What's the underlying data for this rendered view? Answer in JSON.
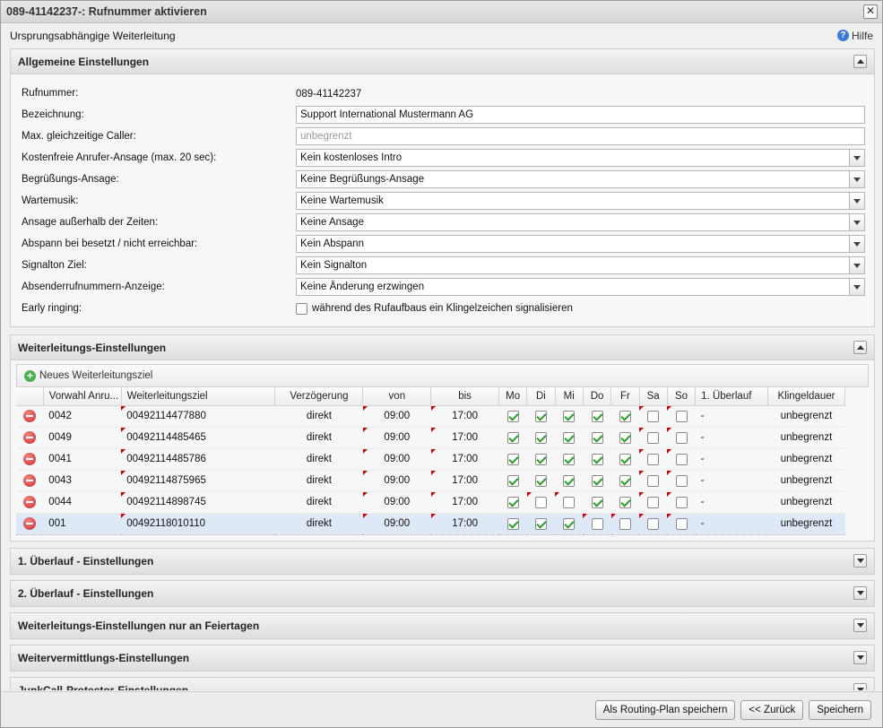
{
  "window": {
    "title": "089-41142237-: Rufnummer aktivieren"
  },
  "subbar": {
    "title": "Ursprungsabhängige Weiterleitung",
    "help_label": "Hilfe"
  },
  "general": {
    "title": "Allgemeine Einstellungen",
    "fields": {
      "rufnummer_label": "Rufnummer:",
      "rufnummer_value": "089-41142237",
      "bezeichnung_label": "Bezeichnung:",
      "bezeichnung_value": "Support International Mustermann AG",
      "max_caller_label": "Max. gleichzeitige Caller:",
      "max_caller_placeholder": "unbegrenzt",
      "intro_label": "Kostenfreie Anrufer-Ansage (max. 20 sec):",
      "intro_value": "Kein kostenloses Intro",
      "greeting_label": "Begrüßungs-Ansage:",
      "greeting_value": "Keine Begrüßungs-Ansage",
      "music_label": "Wartemusik:",
      "music_value": "Keine Wartemusik",
      "offhours_label": "Ansage außerhalb der Zeiten:",
      "offhours_value": "Keine Ansage",
      "outro_label": "Abspann bei besetzt / nicht erreichbar:",
      "outro_value": "Kein Abspann",
      "signal_label": "Signalton Ziel:",
      "signal_value": "Kein Signalton",
      "callerid_label": "Absenderrufnummern-Anzeige:",
      "callerid_value": "Keine Änderung erzwingen",
      "early_label": "Early ringing:",
      "early_text": "während des Rufaufbaus ein Klingelzeichen signalisieren"
    }
  },
  "forwarding": {
    "title": "Weiterleitungs-Einstellungen",
    "add_label": "Neues Weiterleitungsziel",
    "columns": [
      "Vorwahl Anru...",
      "Weiterleitungsziel",
      "Verzögerung",
      "von",
      "bis",
      "Mo",
      "Di",
      "Mi",
      "Do",
      "Fr",
      "Sa",
      "So",
      "1. Überlauf",
      "Klingeldauer"
    ],
    "rows": [
      {
        "vorwahl": "0042",
        "ziel": "00492114477880",
        "delay": "direkt",
        "von": "09:00",
        "bis": "17:00",
        "days": [
          true,
          true,
          true,
          true,
          true,
          false,
          false
        ],
        "overflow": "-",
        "ring": "unbegrenzt"
      },
      {
        "vorwahl": "0049",
        "ziel": "00492114485465",
        "delay": "direkt",
        "von": "09:00",
        "bis": "17:00",
        "days": [
          true,
          true,
          true,
          true,
          true,
          false,
          false
        ],
        "overflow": "-",
        "ring": "unbegrenzt"
      },
      {
        "vorwahl": "0041",
        "ziel": "00492114485786",
        "delay": "direkt",
        "von": "09:00",
        "bis": "17:00",
        "days": [
          true,
          true,
          true,
          true,
          true,
          false,
          false
        ],
        "overflow": "-",
        "ring": "unbegrenzt"
      },
      {
        "vorwahl": "0043",
        "ziel": "00492114875965",
        "delay": "direkt",
        "von": "09:00",
        "bis": "17:00",
        "days": [
          true,
          true,
          true,
          true,
          true,
          false,
          false
        ],
        "overflow": "-",
        "ring": "unbegrenzt"
      },
      {
        "vorwahl": "0044",
        "ziel": "00492114898745",
        "delay": "direkt",
        "von": "09:00",
        "bis": "17:00",
        "days": [
          true,
          false,
          false,
          true,
          true,
          false,
          false
        ],
        "overflow": "-",
        "ring": "unbegrenzt"
      },
      {
        "vorwahl": "001",
        "ziel": "00492118010110",
        "delay": "direkt",
        "von": "09:00",
        "bis": "17:00",
        "days": [
          true,
          true,
          true,
          false,
          false,
          false,
          false
        ],
        "overflow": "-",
        "ring": "unbegrenzt"
      }
    ]
  },
  "collapsed_panels": [
    "1. Überlauf - Einstellungen",
    "2. Überlauf - Einstellungen",
    "Weiterleitungs-Einstellungen nur an Feiertagen",
    "Weitervermittlungs-Einstellungen",
    "JunkCall-Protector-Einstellungen"
  ],
  "footer": {
    "routing_label": "Als Routing-Plan speichern",
    "back_label": "<< Zurück",
    "save_label": "Speichern"
  }
}
